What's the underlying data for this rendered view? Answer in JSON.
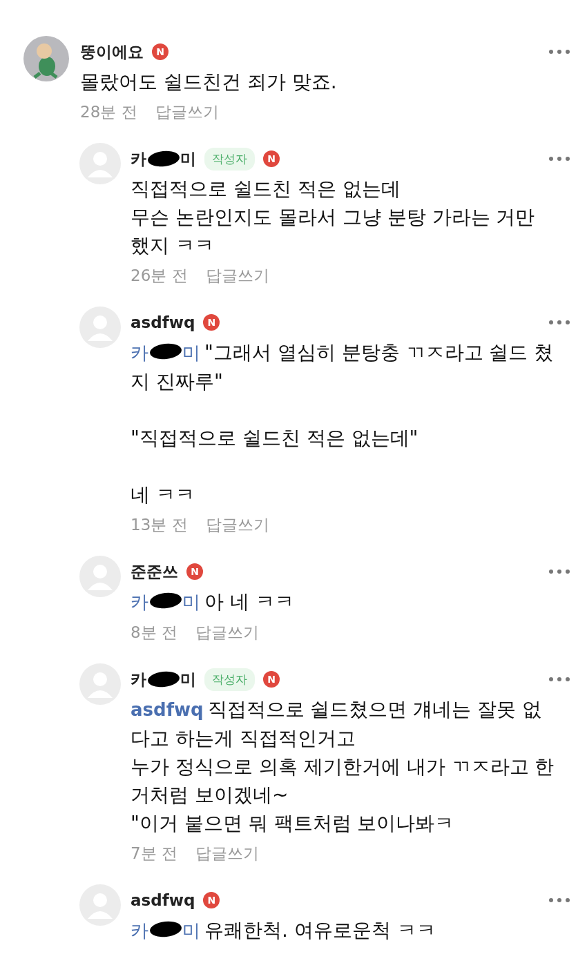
{
  "comments": [
    {
      "author": {
        "text_before": "뚱이에요",
        "redacted": false
      },
      "custom_avatar": true,
      "is_writer": false,
      "badge": "N",
      "paragraphs": [
        "몰랐어도 쉴드친건 죄가 맞죠."
      ],
      "time": "28분 전",
      "reply_label": "답글쓰기",
      "replies": [
        {
          "author": {
            "text_before": "카",
            "text_after": "미",
            "redacted": true
          },
          "custom_avatar": false,
          "is_writer": true,
          "writer_label": "작성자",
          "badge": "N",
          "paragraphs": [
            "직접적으로 쉴드친 적은 없는데\n무슨 논란인지도 몰라서 그냥 분탕 가라는 거만 했지 ㅋㅋ"
          ],
          "time": "26분 전",
          "reply_label": "답글쓰기"
        },
        {
          "author": {
            "text_before": "asdfwq",
            "redacted": false
          },
          "custom_avatar": false,
          "is_writer": false,
          "badge": "N",
          "mention": {
            "text_before": "카",
            "text_after": "미",
            "redacted": true
          },
          "paragraphs": [
            "\"그래서 열심히 분탕충 ㄲㅈ라고 쉴드 쳤지 진짜루\"",
            "\"직접적으로 쉴드친 적은 없는데\"",
            "네 ㅋㅋ"
          ],
          "time": "13분 전",
          "reply_label": "답글쓰기"
        },
        {
          "author": {
            "text_before": "준준쓰",
            "redacted": false
          },
          "custom_avatar": false,
          "is_writer": false,
          "badge": "N",
          "mention": {
            "text_before": "카",
            "text_after": "미",
            "redacted": true
          },
          "paragraphs": [
            "아 네 ㅋㅋ"
          ],
          "time": "8분 전",
          "reply_label": "답글쓰기"
        },
        {
          "author": {
            "text_before": "카",
            "text_after": "미",
            "redacted": true
          },
          "custom_avatar": false,
          "is_writer": true,
          "writer_label": "작성자",
          "badge": "N",
          "mention": {
            "text_before": "asdfwq",
            "redacted": false
          },
          "paragraphs": [
            "직접적으로 쉴드쳤으면 걔네는 잘못 없다고 하는게 직접적인거고\n누가 정식으로 의혹 제기한거에 내가 ㄲㅈ라고 한거처럼 보이겠네~\n\"이거 붙으면 뭐 팩트처럼 보이나봐ㅋ"
          ],
          "time": "7분 전",
          "reply_label": "답글쓰기"
        },
        {
          "author": {
            "text_before": "asdfwq",
            "redacted": false
          },
          "custom_avatar": false,
          "is_writer": false,
          "badge": "N",
          "mention": {
            "text_before": "카",
            "text_after": "미",
            "redacted": true
          },
          "paragraphs": [
            "유쾌한척. 여유로운척 ㅋㅋ"
          ]
        }
      ]
    }
  ]
}
